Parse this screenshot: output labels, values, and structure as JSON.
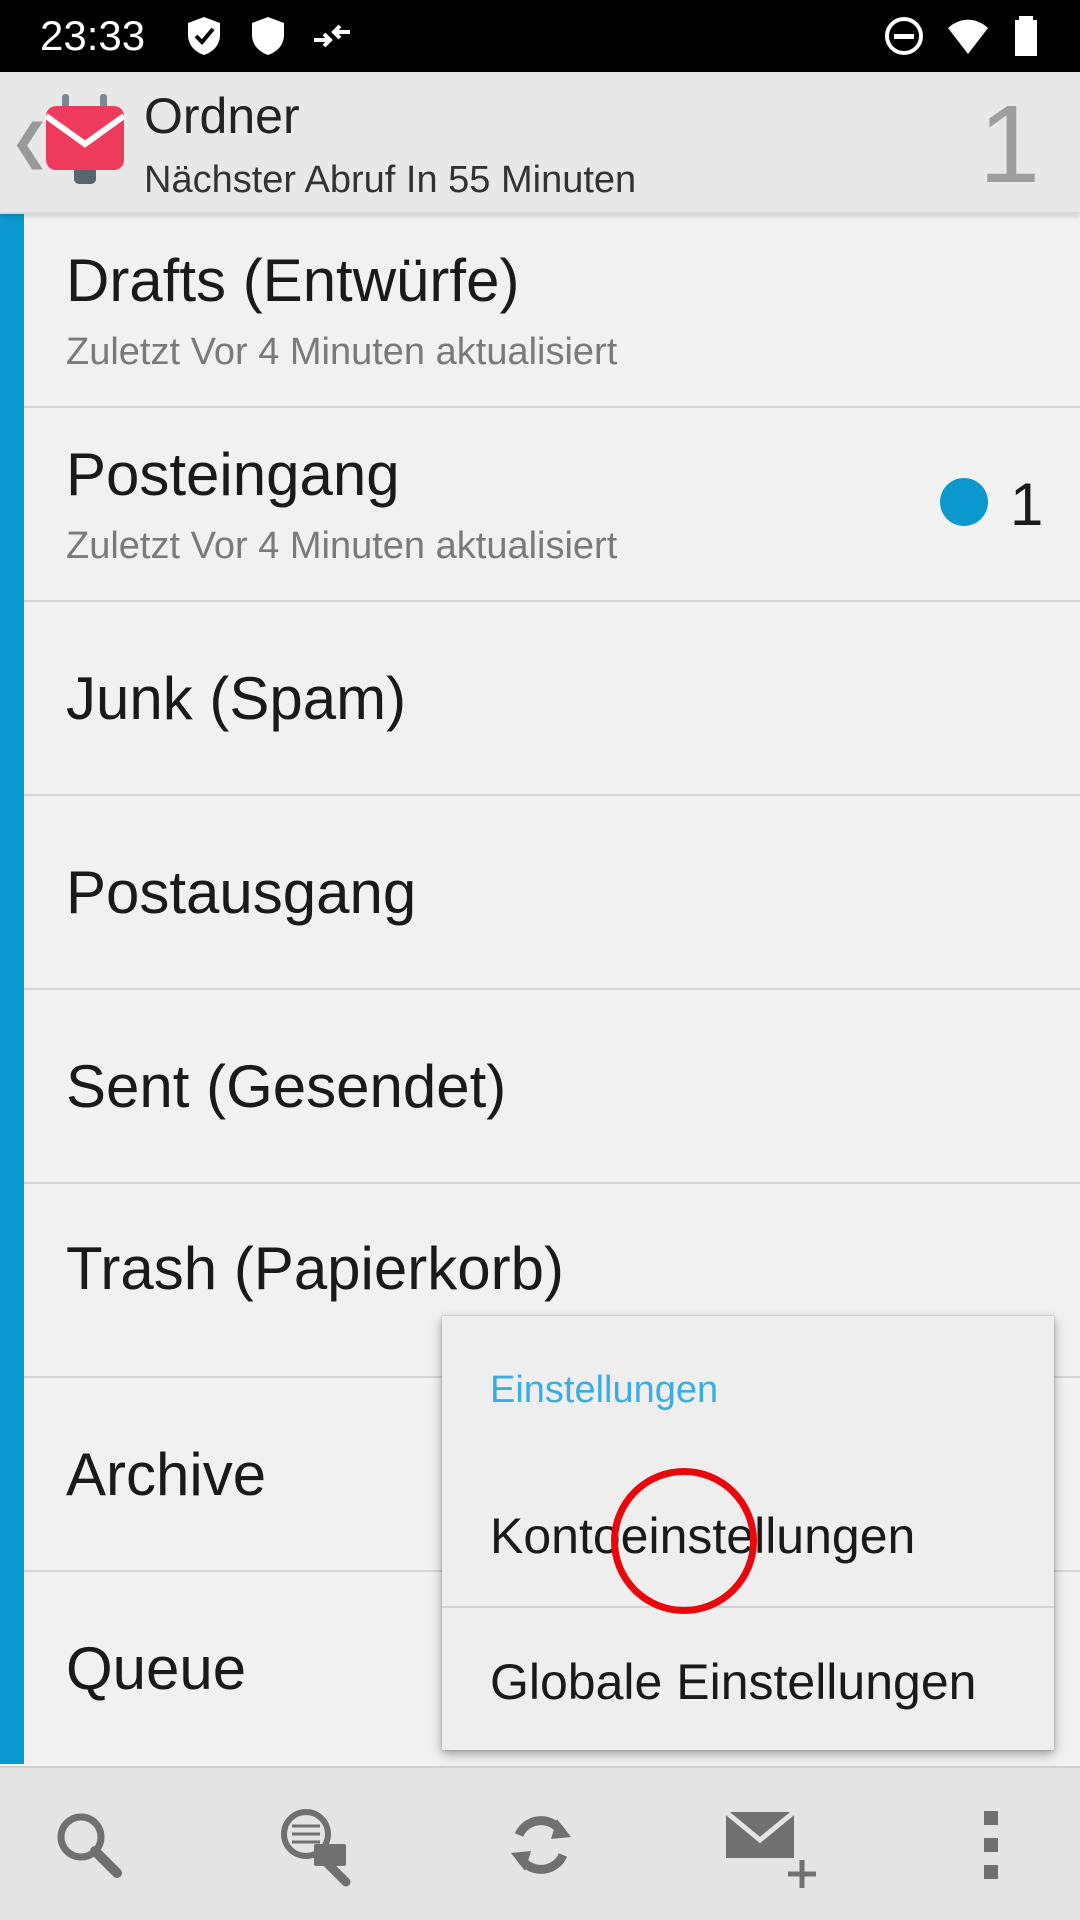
{
  "status_bar": {
    "time": "23:33",
    "left_icons": [
      "check-shield-icon",
      "shield-icon",
      "sync-arrows-icon"
    ],
    "right_icons": [
      "do-not-disturb-icon",
      "wifi-icon",
      "battery-icon"
    ]
  },
  "action_bar": {
    "title": "Ordner",
    "subtitle": "Nächster Abruf In 55 Minuten",
    "unread_total": "1",
    "back_glyph": "❮"
  },
  "folders": [
    {
      "name": "Drafts (Entwürfe)",
      "subtitle": "Zuletzt Vor 4 Minuten aktualisiert"
    },
    {
      "name": "Posteingang",
      "subtitle": "Zuletzt Vor 4 Minuten aktualisiert",
      "unread": "1"
    },
    {
      "name": "Junk (Spam)"
    },
    {
      "name": "Postausgang"
    },
    {
      "name": "Sent (Gesendet)"
    },
    {
      "name": "Trash (Papierkorb)"
    },
    {
      "name": "Archive"
    },
    {
      "name": "Queue"
    }
  ],
  "popup_menu": {
    "header": "Einstellungen",
    "items": [
      {
        "label": "Kontoeinstellungen"
      },
      {
        "label": "Globale Einstellungen"
      }
    ]
  },
  "bottom_toolbar": {
    "buttons": [
      "search-icon",
      "search-remote-icon",
      "refresh-icon",
      "compose-icon",
      "overflow-menu-icon"
    ]
  },
  "colors": {
    "accent": "#0a98cf",
    "menu_header": "#3aaee0",
    "tap_marker": "#e8070b",
    "app_logo": "#ee3b5b"
  }
}
